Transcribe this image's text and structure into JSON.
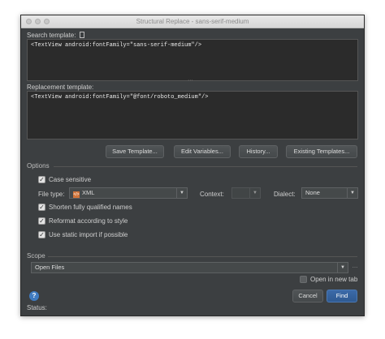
{
  "window": {
    "title": "Structural Replace - sans-serif-medium"
  },
  "search": {
    "label": "Search template:",
    "code": "<TextView android:fontFamily=\"sans-serif-medium\"/>"
  },
  "replacement": {
    "label": "Replacement template:",
    "code": "<TextView android:fontFamily=\"@font/roboto_medium\"/>"
  },
  "toolbar": {
    "save_template": "Save Template...",
    "edit_variables": "Edit Variables...",
    "history": "History...",
    "existing_templates": "Existing Templates..."
  },
  "options": {
    "section_label": "Options",
    "case_sensitive": "Case sensitive",
    "file_type_label": "File type:",
    "file_type_value": "XML",
    "context_label": "Context:",
    "dialect_label": "Dialect:",
    "dialect_value": "None",
    "shorten_names": "Shorten fully qualified names",
    "reformat": "Reformat according to style",
    "static_import": "Use static import if possible"
  },
  "scope": {
    "section_label": "Scope",
    "value": "Open Files",
    "open_new_tab": "Open in new tab"
  },
  "footer": {
    "help_glyph": "?",
    "status_label": "Status:",
    "cancel": "Cancel",
    "find": "Find"
  },
  "icons": {
    "help": "help-icon",
    "chevron": "chevron-down-icon",
    "check": "check-icon",
    "xml": "xml-file-icon",
    "more": "ellipsis-icon"
  }
}
